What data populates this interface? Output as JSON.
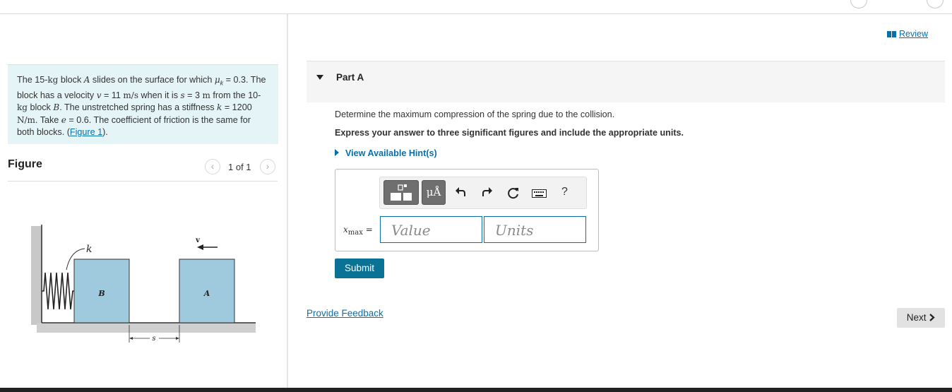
{
  "header": {
    "review_label": "Review"
  },
  "problem": {
    "segments": [
      {
        "t": "The 15-"
      },
      {
        "t": "kg",
        "c": "u"
      },
      {
        "t": " block "
      },
      {
        "t": "A",
        "c": "i"
      },
      {
        "t": " slides on the surface for which "
      },
      {
        "t": "μ",
        "c": "i"
      },
      {
        "t": "k",
        "c": "sub"
      },
      {
        "t": " = 0.3. The block has a velocity "
      },
      {
        "t": "v",
        "c": "i"
      },
      {
        "t": " = 11 "
      },
      {
        "t": "m/s",
        "c": "u"
      },
      {
        "t": " when it is "
      },
      {
        "t": "s",
        "c": "i"
      },
      {
        "t": " = 3 "
      },
      {
        "t": "m",
        "c": "u"
      },
      {
        "t": " from the 10-"
      },
      {
        "t": "kg",
        "c": "u"
      },
      {
        "t": " block "
      },
      {
        "t": "B",
        "c": "i"
      },
      {
        "t": ". The unstretched spring has a stiffness "
      },
      {
        "t": "k",
        "c": "i"
      },
      {
        "t": " = 1200 "
      },
      {
        "t": "N/m",
        "c": "u"
      },
      {
        "t": ". Take "
      },
      {
        "t": "e",
        "c": "i"
      },
      {
        "t": " = 0.6. The coefficient of friction is the same for both blocks. ("
      },
      {
        "t": "Figure 1",
        "c": "link"
      },
      {
        "t": ")."
      }
    ]
  },
  "figure": {
    "title": "Figure",
    "pager": "1 of 1",
    "prev_icon": "chevron-left-icon",
    "next_icon": "chevron-right-icon",
    "labels": {
      "k": "k",
      "v": "v",
      "block_b": "B",
      "block_a": "A",
      "s": "s"
    },
    "block_color": "#9fc9dd"
  },
  "part": {
    "title": "Part A",
    "question": "Determine the maximum compression of the spring due to the collision.",
    "instruction": "Express your answer to three significant figures and include the appropriate units.",
    "hints_label": "View Available Hint(s)",
    "toolbar": {
      "units_button": "μÅ",
      "help_label": "?",
      "icons": [
        "templates-icon",
        "units-icon",
        "undo-icon",
        "redo-icon",
        "reset-icon",
        "keyboard-icon",
        "help-icon"
      ]
    },
    "variable": "x",
    "variable_sub": "max",
    "equals": "=",
    "value_placeholder": "Value",
    "units_placeholder": "Units",
    "submit_label": "Submit"
  },
  "footer": {
    "feedback_label": "Provide Feedback",
    "next_label": "Next"
  },
  "colors": {
    "accent": "#0a6fa8",
    "submit": "#0a7294",
    "problem_bg": "#e5f4f6"
  }
}
